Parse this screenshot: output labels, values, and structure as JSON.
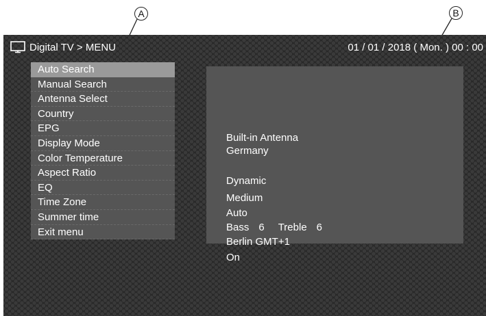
{
  "annotations": {
    "a": "A",
    "b": "B"
  },
  "header": {
    "title": "Digital TV > MENU",
    "datetime": "01 / 01 / 2018 ( Mon. ) 00 : 00"
  },
  "menu": {
    "selected_index": 0,
    "items": [
      {
        "label": "Auto Search"
      },
      {
        "label": "Manual Search"
      },
      {
        "label": "Antenna Select"
      },
      {
        "label": "Country"
      },
      {
        "label": "EPG"
      },
      {
        "label": "Display Mode"
      },
      {
        "label": "Color Temperature"
      },
      {
        "label": "Aspect Ratio"
      },
      {
        "label": "EQ"
      },
      {
        "label": "Time Zone"
      },
      {
        "label": "Summer time"
      },
      {
        "label": "Exit menu"
      }
    ]
  },
  "values": {
    "antenna": "Built-in Antenna",
    "country": "Germany",
    "display_mode": "Dynamic",
    "color_temperature": "Medium",
    "aspect_ratio": "Auto",
    "eq": {
      "bass_label": "Bass",
      "bass_value": "6",
      "treble_label": "Treble",
      "treble_value": "6"
    },
    "time_zone": "Berlin GMT+1",
    "summer_time": "On"
  },
  "colors": {
    "menu_bg": "#555555",
    "menu_selected_bg": "#9a9a9a",
    "text": "#ffffff",
    "screen_bg": "#2f2f2f"
  },
  "icons": {
    "header_icon": "tv-icon"
  }
}
